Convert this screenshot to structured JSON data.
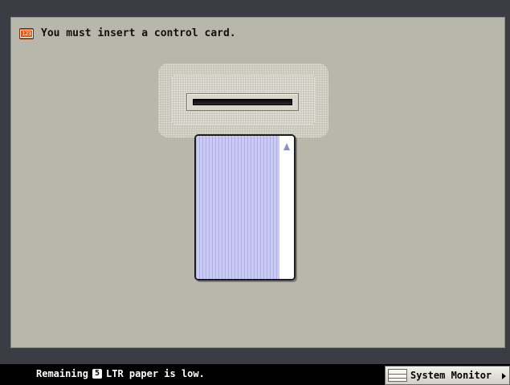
{
  "message": {
    "icon": "counter-123-icon",
    "counter_text": "123",
    "text": "You must insert a control card."
  },
  "illustration": {
    "slot_icon": "card-slot-icon",
    "card_icon": "control-card-icon",
    "arrow_icon": "insert-direction-arrow-icon"
  },
  "status": {
    "prefix": "Remaining",
    "drawer_number": "5",
    "suffix": "LTR paper is low."
  },
  "system_monitor": {
    "label": "System Monitor",
    "icon": "monitor-icon",
    "arrow_icon": "play-arrow-icon"
  },
  "colors": {
    "panel_bg": "#b8b7ab",
    "frame_bg": "#3c3c44",
    "status_bg": "#000000",
    "accent_orange": "#d65b1e",
    "card_stripe": "#cacbf0"
  }
}
